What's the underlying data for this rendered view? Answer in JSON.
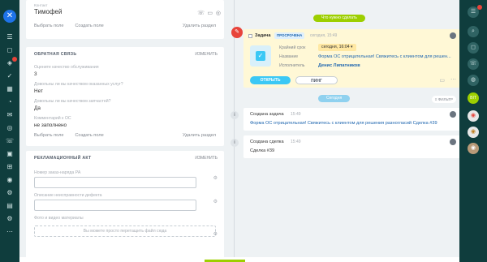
{
  "colors": {
    "accent_blue": "#1e73e8",
    "accent_green": "#9dcf00",
    "task_bg": "#fff8d6",
    "danger": "#e8443a",
    "link": "#2067b0"
  },
  "contact_card": {
    "label": "Контакт",
    "name": "Тимофей",
    "choose_field": "Выбрать поле",
    "create_field": "Создать поле",
    "delete_section": "Удалить раздел"
  },
  "feedback_card": {
    "title": "ОБРАТНАЯ СВЯЗЬ",
    "edit": "изменить",
    "fields": [
      {
        "label": "Оцените качество обслуживания",
        "value": "3"
      },
      {
        "label": "Довольны ли вы качеством оказанных услуг?",
        "value": "Нет"
      },
      {
        "label": "Довольны ли вы качеством запчастей?",
        "value": "Да"
      },
      {
        "label": "Комментарий к ОС",
        "value": "не заполнено"
      }
    ],
    "choose_field": "Выбрать поле",
    "create_field": "Создать поле",
    "delete_section": "Удалить раздел"
  },
  "claim_card": {
    "title": "РЕКЛАМАЦИОННЫЙ АКТ",
    "edit": "изменить",
    "field1_label": "Номер заказ-наряда РА",
    "field2_label": "Описание неисправности дефекта",
    "field3_label": "Фото и видео материалы",
    "dropzone": "Вы можете просто перетащить файл сюда"
  },
  "timeline": {
    "todo_pill": "Что нужно сделать",
    "task": {
      "type": "Задача",
      "status": "ПРОСРОЧЕНА",
      "time": "сегодня, 15:49",
      "deadline_label": "Крайний срок",
      "deadline_value": "сегодня, 16:04",
      "name_label": "Название",
      "name_value": "Форма ОС отрицательная! Свяжитесь с клиентом для решен...",
      "executor_label": "Исполнитель",
      "executor_value": "Денис Липатников",
      "open_button": "ОТКРЫТЬ",
      "ping_button": "ПИНГ"
    },
    "today_pill": "Сегодня",
    "filter_label": "ФИЛЬТР",
    "events": [
      {
        "title": "Создана задача",
        "time": "15:49",
        "text": "Форма ОС отрицательная! Свяжитесь с клиентом для решения разногласий Сделка #39"
      },
      {
        "title": "Создана сделка",
        "time": "15:49",
        "text": "Сделка #39"
      }
    ]
  },
  "left_rail_icons": [
    "close-icon",
    "menu-icon",
    "chat-icon",
    "feed-icon",
    "tasks-icon",
    "calendar-icon",
    "drive-icon",
    "mail-icon",
    "crm-icon",
    "contact-center-icon",
    "sites-icon",
    "store-icon",
    "marketing-icon",
    "automation-icon",
    "company-icon",
    "settings-icon",
    "more-icon"
  ],
  "right_rail_badges": {
    "top": "12",
    "bitrix": "BIT"
  }
}
